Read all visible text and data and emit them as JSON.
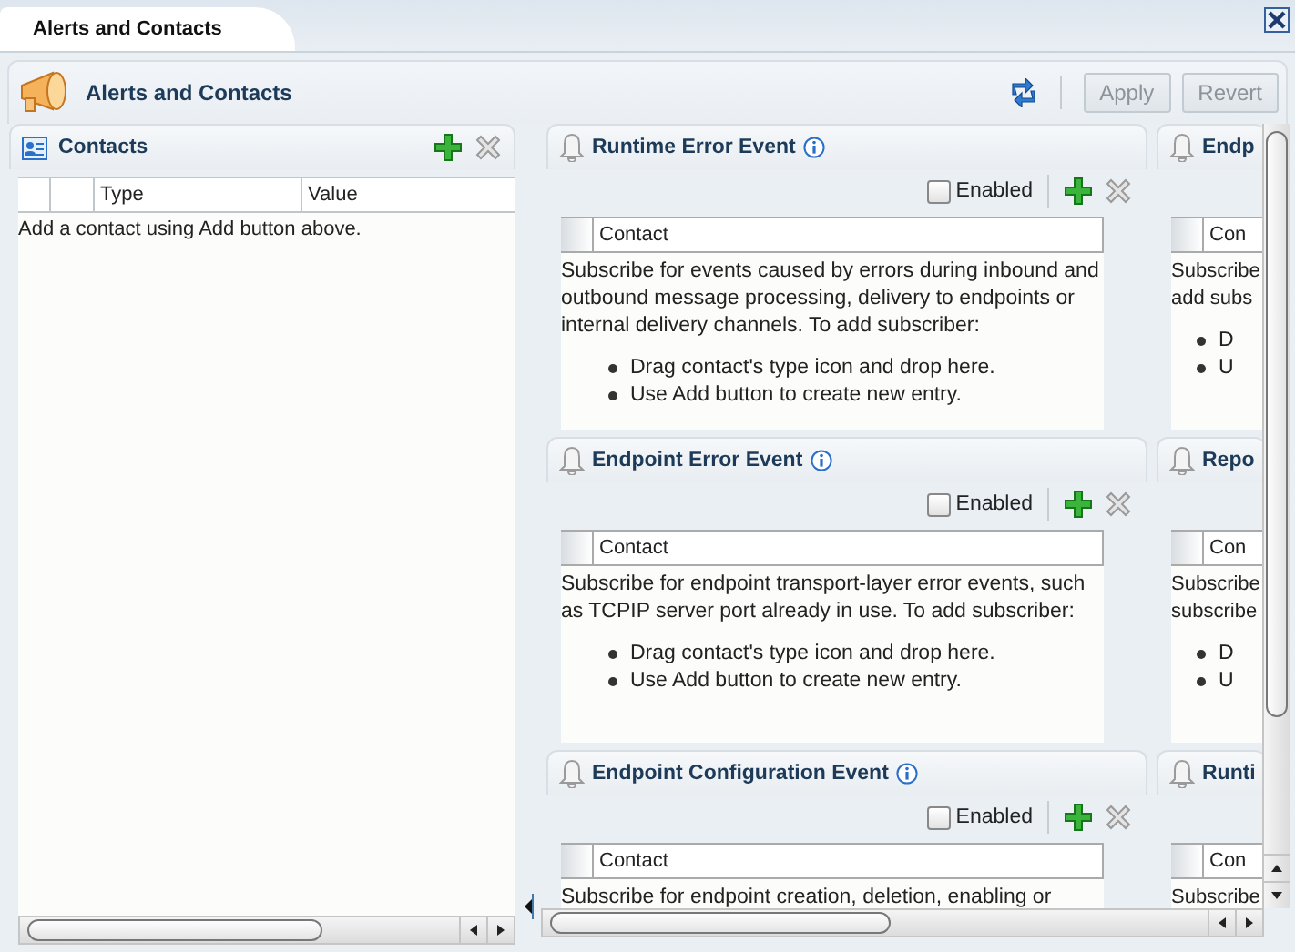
{
  "window": {
    "tab": "Alerts and Contacts"
  },
  "header": {
    "title": "Alerts and Contacts",
    "buttons": [
      {
        "label": "Apply",
        "disabled": true
      },
      {
        "label": "Revert",
        "disabled": true
      }
    ]
  },
  "contacts": {
    "title": "Contacts",
    "columns": [
      "",
      "",
      "Type",
      "Value"
    ],
    "empty_message": "Add a contact using Add button above."
  },
  "event_columns": [
    {
      "cards": [
        {
          "title": "Runtime Error Event",
          "enabled": false,
          "enabled_label": "Enabled",
          "column": "Contact",
          "description": "Subscribe for events caused by errors during inbound and outbound message processing, delivery to endpoints or internal delivery channels.   To add subscriber:",
          "bullets": [
            "Drag contact's type icon and drop here.",
            "Use Add button to create new entry."
          ]
        },
        {
          "title": "Endpoint Error Event",
          "enabled": false,
          "enabled_label": "Enabled",
          "column": "Contact",
          "description": "Subscribe for endpoint transport-layer error events, such as TCPIP server port already in use.  To add subscriber:",
          "bullets": [
            "Drag contact's type icon and drop here.",
            "Use Add button to create new entry."
          ]
        },
        {
          "title": "Endpoint Configuration Event",
          "enabled": false,
          "enabled_label": "Enabled",
          "column": "Contact",
          "description": "Subscribe for endpoint creation, deletion, enabling or"
        }
      ]
    },
    {
      "cards": [
        {
          "title": "Endp",
          "column": "Con",
          "description": "Subscribe add subs",
          "bullets": [
            "D",
            "U"
          ]
        },
        {
          "title": "Repo",
          "column": "Con",
          "description": "Subscribe subscribe",
          "bullets": [
            "D",
            "U"
          ]
        },
        {
          "title": "Runti",
          "column": "Con",
          "description": "Subscribe"
        }
      ]
    }
  ]
}
